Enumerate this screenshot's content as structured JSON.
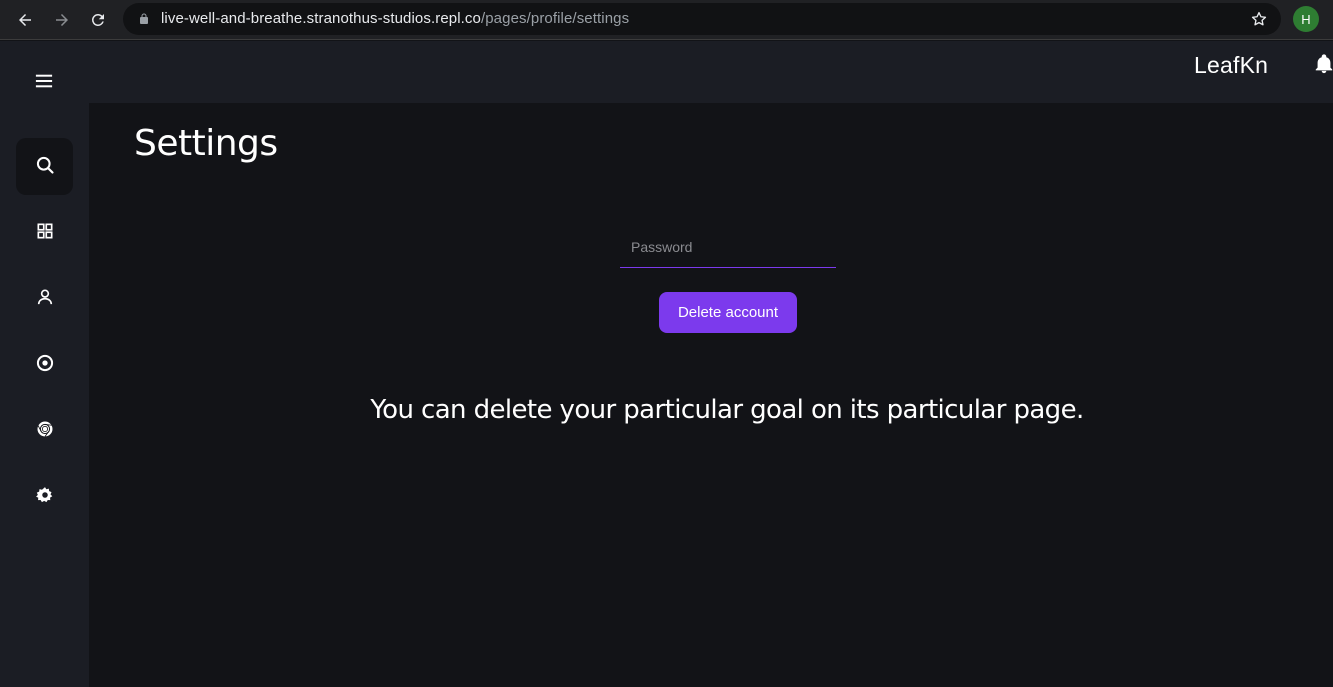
{
  "browser": {
    "url_host": "live-well-and-breathe.stranothus-studios.repl.co",
    "url_path": "/pages/profile/settings",
    "profile_initial": "H",
    "icons": [
      "back-arrow-icon",
      "forward-arrow-icon",
      "reload-icon",
      "lock-icon",
      "star-icon"
    ]
  },
  "header": {
    "brand": "LeafKn",
    "icons": [
      "hamburger-icon",
      "bell-icon"
    ]
  },
  "sidebar": {
    "items": [
      {
        "name": "search",
        "icon": "search-icon",
        "active": true
      },
      {
        "name": "dashboard",
        "icon": "grid-icon",
        "active": false
      },
      {
        "name": "profile",
        "icon": "user-icon",
        "active": false
      },
      {
        "name": "goals",
        "icon": "target-icon",
        "active": false
      },
      {
        "name": "browser",
        "icon": "chrome-icon",
        "active": false
      },
      {
        "name": "settings",
        "icon": "gear-icon",
        "active": false
      }
    ]
  },
  "main": {
    "title": "Settings",
    "password_placeholder": "Password",
    "delete_button_label": "Delete account",
    "info_text": "You can delete your particular goal on its particular page."
  },
  "colors": {
    "accent": "#7c3aed",
    "background": "#121317",
    "panel": "#1b1d24",
    "browser_chrome": "#202124"
  }
}
